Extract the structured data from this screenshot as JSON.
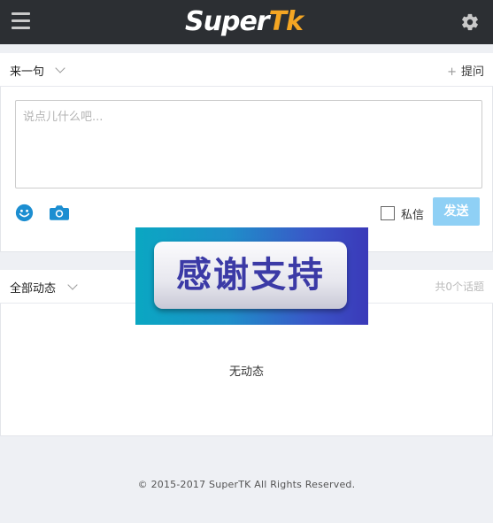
{
  "header": {
    "logo_primary": "Super",
    "logo_accent": "Tk",
    "logo_accent_color": "#f5a623",
    "menu_icon": "hamburger-icon",
    "settings_icon": "gear-icon"
  },
  "compose": {
    "title": "来一句",
    "ask_label": "提问",
    "ask_icon": "plus-icon",
    "placeholder": "说点儿什么吧...",
    "private_label": "私信",
    "send_label": "发送",
    "send_color": "#8fd0f5",
    "emoji_icon": "emoji-icon",
    "camera_icon": "camera-icon"
  },
  "feed": {
    "title": "全部动态",
    "topic_count": "共0个话题",
    "empty_text": "无动态"
  },
  "overlay": {
    "text": "感谢支持"
  },
  "footer": {
    "copyright": "© 2015-2017 SuperTK All Rights Reserved."
  }
}
